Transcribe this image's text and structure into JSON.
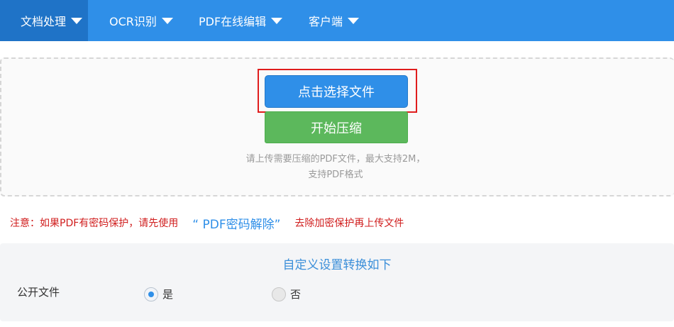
{
  "nav": {
    "items": [
      {
        "label": "文档处理",
        "active": true
      },
      {
        "label": "OCR识别",
        "active": false
      },
      {
        "label": "PDF在线编辑",
        "active": false
      },
      {
        "label": "客户端",
        "active": false
      }
    ]
  },
  "upload": {
    "select_button": "点击选择文件",
    "compress_button": "开始压缩",
    "hint_line1": "请上传需要压缩的PDF文件，最大支持2M，",
    "hint_line2": "支持PDF格式"
  },
  "notice": {
    "prefix": "注意：如果PDF有密码保护，请先使用",
    "link": "“ PDF密码解除”",
    "suffix": "去除加密保护再上传文件"
  },
  "settings": {
    "title": "自定义设置转换如下",
    "public_file": {
      "label": "公开文件",
      "options": [
        {
          "label": "是",
          "checked": true
        },
        {
          "label": "否",
          "checked": false
        }
      ]
    }
  },
  "colors": {
    "nav_bg": "#2f8fe8",
    "nav_active": "#1f73c7",
    "primary": "#2f8fe8",
    "success": "#5cb85c",
    "warning_text": "#d01d1d",
    "highlight_frame": "#e01d1d"
  }
}
